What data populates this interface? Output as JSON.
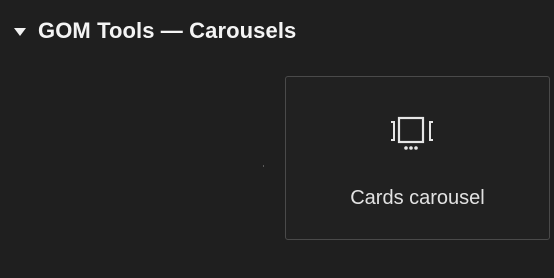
{
  "section": {
    "title": "GOM Tools — Carousels",
    "expanded": true,
    "caret_icon": "caret-down-icon"
  },
  "widgets": [
    {
      "label": "Cards carousel",
      "icon": "carousel-icon"
    }
  ],
  "colors": {
    "background": "#1f1f1f",
    "text": "#f4f4f4",
    "card_border": "#4a4a4a"
  }
}
